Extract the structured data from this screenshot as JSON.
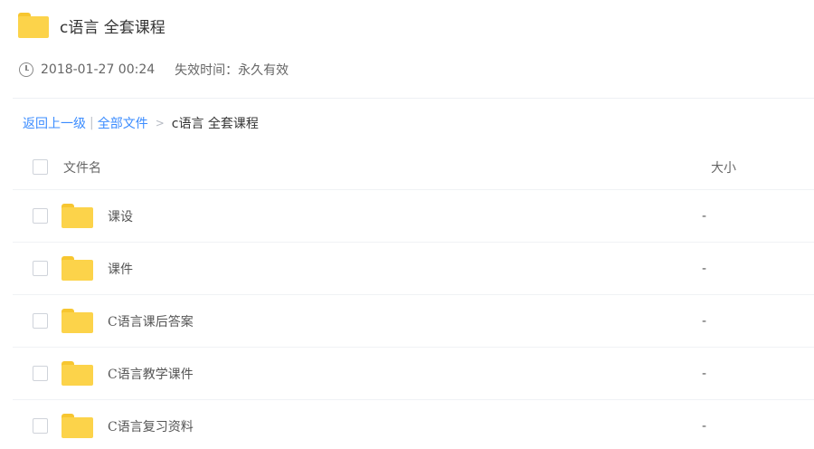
{
  "share": {
    "title": "c语言 全套课程",
    "date": "2018-01-27 00:24",
    "expire": "失效时间：永久有效"
  },
  "breadcrumb": {
    "back": "返回上一级",
    "separator": "|",
    "all_files": "全部文件",
    "arrow": ">",
    "current": "c语言 全套课程"
  },
  "list": {
    "header_name": "文件名",
    "header_size": "大小",
    "rows": [
      {
        "name": "课设",
        "size": "-"
      },
      {
        "name": "课件",
        "size": "-"
      },
      {
        "name": "C语言课后答案",
        "size": "-"
      },
      {
        "name": "C语言教学课件",
        "size": "-"
      },
      {
        "name": "C语言复习资料",
        "size": "-"
      }
    ]
  },
  "icons": {
    "folder": "folder-icon",
    "clock": "clock-icon",
    "folder_color": "#fcd34a",
    "link_color": "#3b8cff"
  }
}
